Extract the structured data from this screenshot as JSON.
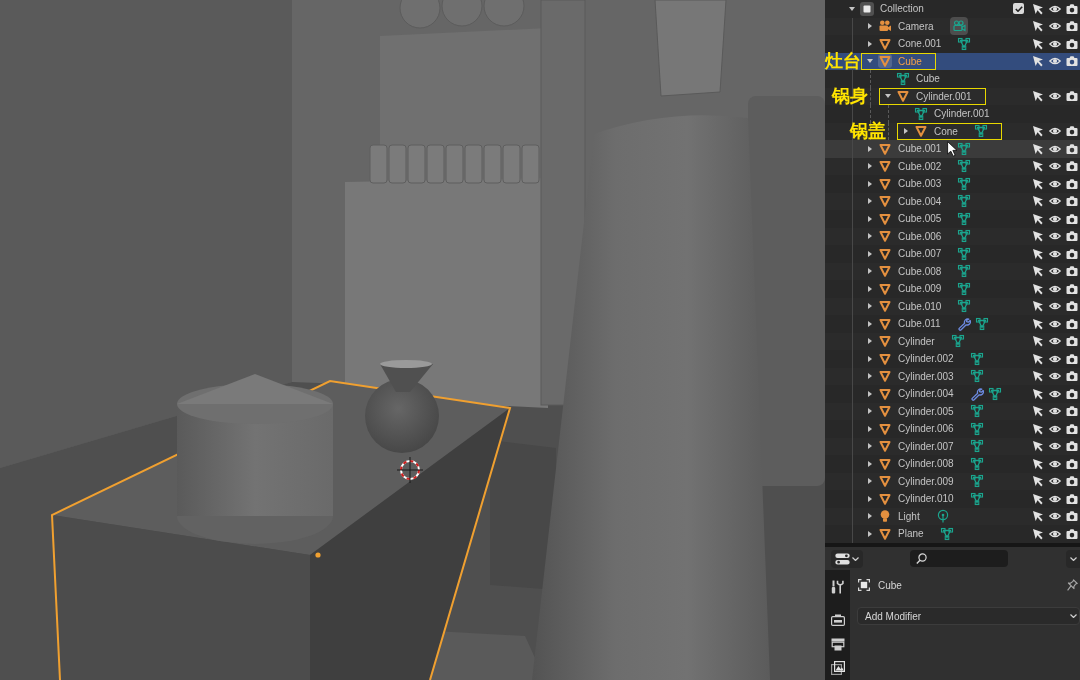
{
  "outliner": {
    "items": [
      {
        "name": "Collection",
        "kind": "collection",
        "expanded": true,
        "checked": true,
        "selected": false,
        "hovered": false,
        "children": [
          {
            "name": "Camera",
            "kind": "camera",
            "expanded": false,
            "selected": false,
            "hovered": false,
            "modifiers": false
          },
          {
            "name": "Cone.001",
            "kind": "mesh",
            "expanded": false,
            "selected": false,
            "hovered": false,
            "modifiers": false
          },
          {
            "name": "Cube",
            "kind": "mesh",
            "expanded": true,
            "selected": true,
            "hovered": false,
            "annotation": "灶台",
            "children": [
              {
                "name": "Cube",
                "kind": "mesh_data",
                "selected": false,
                "hovered": false
              },
              {
                "name": "Cylinder.001",
                "kind": "mesh",
                "expanded": true,
                "selected": false,
                "hovered": false,
                "annotation": "锅身",
                "children": [
                  {
                    "name": "Cylinder.001",
                    "kind": "mesh_data",
                    "selected": false,
                    "hovered": false
                  },
                  {
                    "name": "Cone",
                    "kind": "mesh",
                    "expanded": false,
                    "selected": false,
                    "hovered": false,
                    "modifiers": false,
                    "annotation": "锅盖"
                  }
                ]
              }
            ]
          },
          {
            "name": "Cube.001",
            "kind": "mesh",
            "expanded": false,
            "selected": false,
            "hovered": true,
            "modifiers": false
          },
          {
            "name": "Cube.002",
            "kind": "mesh",
            "expanded": false,
            "selected": false,
            "hovered": false,
            "modifiers": false
          },
          {
            "name": "Cube.003",
            "kind": "mesh",
            "expanded": false,
            "selected": false,
            "hovered": false,
            "modifiers": false
          },
          {
            "name": "Cube.004",
            "kind": "mesh",
            "expanded": false,
            "selected": false,
            "hovered": false,
            "modifiers": false
          },
          {
            "name": "Cube.005",
            "kind": "mesh",
            "expanded": false,
            "selected": false,
            "hovered": false,
            "modifiers": false
          },
          {
            "name": "Cube.006",
            "kind": "mesh",
            "expanded": false,
            "selected": false,
            "hovered": false,
            "modifiers": false
          },
          {
            "name": "Cube.007",
            "kind": "mesh",
            "expanded": false,
            "selected": false,
            "hovered": false,
            "modifiers": false
          },
          {
            "name": "Cube.008",
            "kind": "mesh",
            "expanded": false,
            "selected": false,
            "hovered": false,
            "modifiers": false
          },
          {
            "name": "Cube.009",
            "kind": "mesh",
            "expanded": false,
            "selected": false,
            "hovered": false,
            "modifiers": false
          },
          {
            "name": "Cube.010",
            "kind": "mesh",
            "expanded": false,
            "selected": false,
            "hovered": false,
            "modifiers": false
          },
          {
            "name": "Cube.011",
            "kind": "mesh",
            "expanded": false,
            "selected": false,
            "hovered": false,
            "modifiers": true
          },
          {
            "name": "Cylinder",
            "kind": "mesh",
            "expanded": false,
            "selected": false,
            "hovered": false,
            "modifiers": false
          },
          {
            "name": "Cylinder.002",
            "kind": "mesh",
            "expanded": false,
            "selected": false,
            "hovered": false,
            "modifiers": false
          },
          {
            "name": "Cylinder.003",
            "kind": "mesh",
            "expanded": false,
            "selected": false,
            "hovered": false,
            "modifiers": false
          },
          {
            "name": "Cylinder.004",
            "kind": "mesh",
            "expanded": false,
            "selected": false,
            "hovered": false,
            "modifiers": true
          },
          {
            "name": "Cylinder.005",
            "kind": "mesh",
            "expanded": false,
            "selected": false,
            "hovered": false,
            "modifiers": false
          },
          {
            "name": "Cylinder.006",
            "kind": "mesh",
            "expanded": false,
            "selected": false,
            "hovered": false,
            "modifiers": false
          },
          {
            "name": "Cylinder.007",
            "kind": "mesh",
            "expanded": false,
            "selected": false,
            "hovered": false,
            "modifiers": false
          },
          {
            "name": "Cylinder.008",
            "kind": "mesh",
            "expanded": false,
            "selected": false,
            "hovered": false,
            "modifiers": false
          },
          {
            "name": "Cylinder.009",
            "kind": "mesh",
            "expanded": false,
            "selected": false,
            "hovered": false,
            "modifiers": false
          },
          {
            "name": "Cylinder.010",
            "kind": "mesh",
            "expanded": false,
            "selected": false,
            "hovered": false,
            "modifiers": false
          },
          {
            "name": "Light",
            "kind": "light",
            "expanded": false,
            "selected": false,
            "hovered": false,
            "modifiers": false
          },
          {
            "name": "Plane",
            "kind": "mesh",
            "expanded": false,
            "selected": false,
            "hovered": false,
            "modifiers": false
          }
        ]
      }
    ]
  },
  "properties": {
    "object": {
      "name": "Cube"
    },
    "add_modifier": {
      "label": "Add Modifier"
    }
  }
}
